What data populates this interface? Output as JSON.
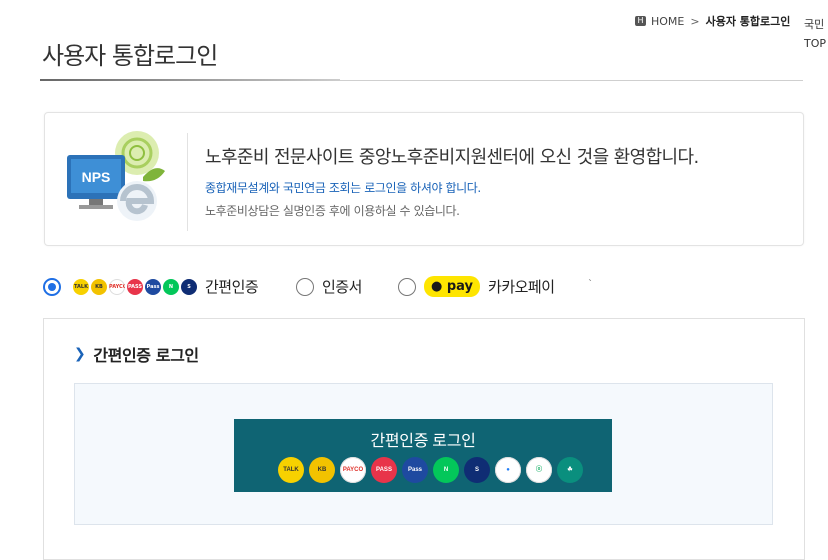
{
  "breadcrumb": {
    "home_icon": "H",
    "home": "HOME",
    "separator": ">",
    "current": "사용자 통합로그인"
  },
  "side_links": {
    "first": "국민",
    "second": "TOP"
  },
  "page_title": "사용자 통합로그인",
  "welcome": {
    "logo_text": "NPS",
    "main": "노후준비 전문사이트 중앙노후준비지원센터에 오신 것을 환영합니다.",
    "sub1": "종합재무설계와 국민연금 조회는 로그인을 하셔야 합니다.",
    "sub2": "노후준비상담은 실명인증 후에 이용하실 수 있습니다."
  },
  "login_options": [
    {
      "label": "간편인증",
      "selected": true
    },
    {
      "label": "인증서",
      "selected": false
    },
    {
      "label": "카카오페이",
      "badge": "pay",
      "selected": false
    }
  ],
  "option_tick": "`",
  "mini_icons": [
    {
      "name": "talk-icon",
      "text": "TALK",
      "color": "#f7d100",
      "fg": "#333"
    },
    {
      "name": "kb-icon",
      "text": "KB",
      "color": "#f2c200",
      "fg": "#333"
    },
    {
      "name": "payco-icon",
      "text": "PAYCO",
      "color": "#ffffff",
      "fg": "#e0322b"
    },
    {
      "name": "pass-icon",
      "text": "PASS",
      "color": "#e8344a",
      "fg": "#fff"
    },
    {
      "name": "samsung-pass-icon",
      "text": "Pass",
      "color": "#1e4aa0",
      "fg": "#fff"
    },
    {
      "name": "naver-icon",
      "text": "N",
      "color": "#03c75a",
      "fg": "#fff"
    },
    {
      "name": "shinhan-icon",
      "text": "S",
      "color": "#0f2d74",
      "fg": "#fff"
    }
  ],
  "panel": {
    "title": "간편인증 로그인",
    "button_label": "간편인증 로그인",
    "icons": [
      {
        "name": "talk-icon",
        "text": "TALK",
        "color": "#f7d100",
        "fg": "#333"
      },
      {
        "name": "kb-icon",
        "text": "KB",
        "color": "#f2c200",
        "fg": "#333"
      },
      {
        "name": "payco-icon",
        "text": "PAYCO",
        "color": "#ffffff",
        "fg": "#e0322b"
      },
      {
        "name": "pass-icon",
        "text": "PASS",
        "color": "#e8344a",
        "fg": "#fff"
      },
      {
        "name": "samsung-pass-icon",
        "text": "Pass",
        "color": "#1e4aa0",
        "fg": "#fff"
      },
      {
        "name": "naver-icon",
        "text": "N",
        "color": "#03c75a",
        "fg": "#fff"
      },
      {
        "name": "shinhan-icon",
        "text": "S",
        "color": "#0f2d74",
        "fg": "#fff"
      },
      {
        "name": "toss-icon",
        "text": "●",
        "color": "#ffffff",
        "fg": "#1f7cf6"
      },
      {
        "name": "bank-icon",
        "text": "ⓞ",
        "color": "#ffffff",
        "fg": "#2bb673"
      },
      {
        "name": "hana-icon",
        "text": "☘",
        "color": "#0a8f7e",
        "fg": "#fff"
      }
    ]
  },
  "colors": {
    "accent": "#1f6fe5",
    "button": "#0f6473",
    "link_blue": "#1a63b8"
  }
}
